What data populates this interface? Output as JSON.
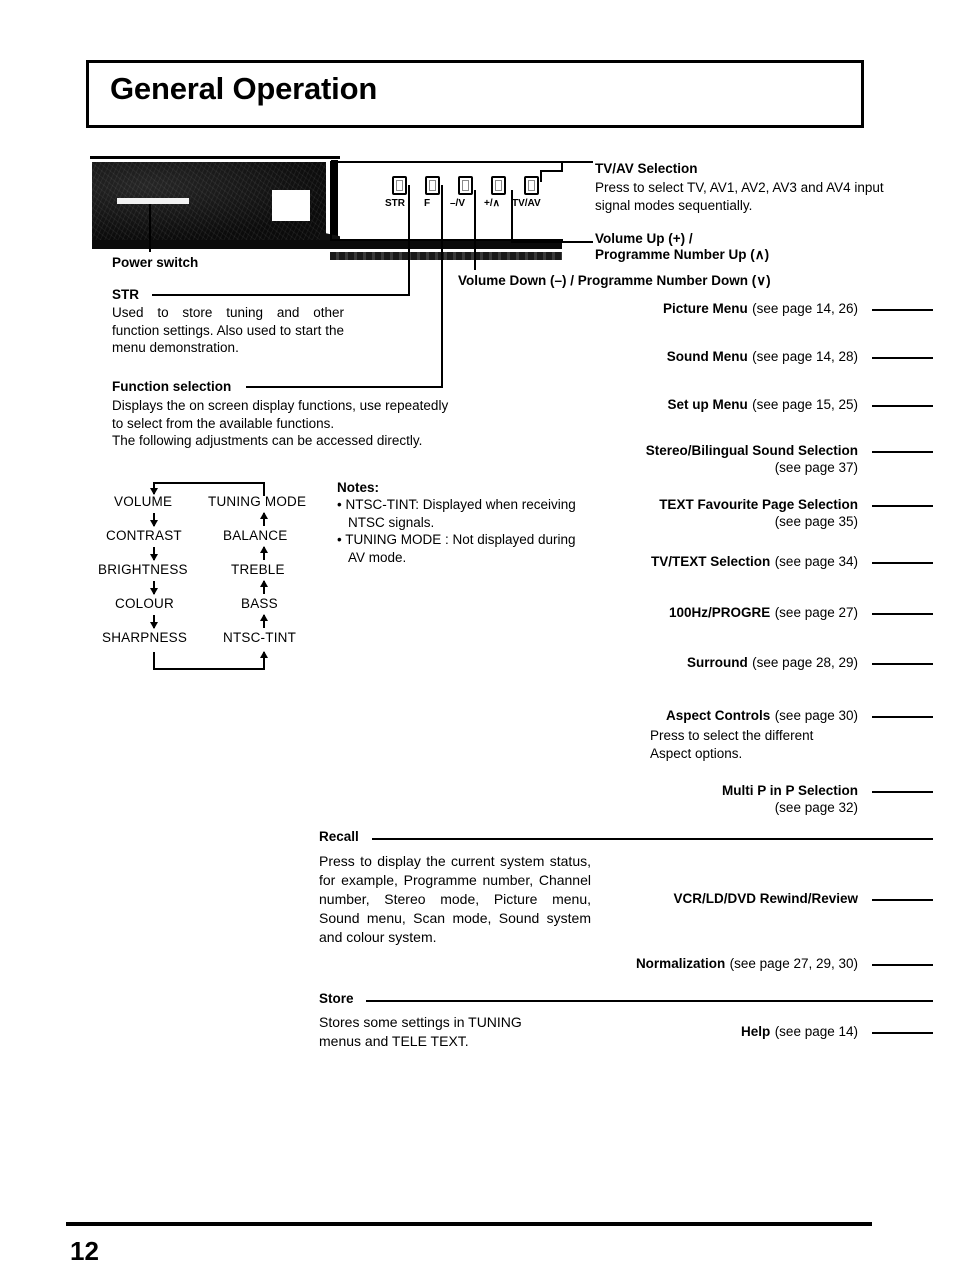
{
  "page": {
    "title": "General Operation",
    "number": "12"
  },
  "photo": {
    "power_switch_label": "Power switch"
  },
  "control_panel": {
    "buttons": [
      {
        "label": "STR"
      },
      {
        "label": "F"
      },
      {
        "label": "–/V"
      },
      {
        "label": "+/∧"
      },
      {
        "label": "TV/AV"
      }
    ]
  },
  "callouts": {
    "tvav": {
      "heading": "TV/AV Selection",
      "body": "Press to select TV, AV1, AV2, AV3 and AV4 input signal modes sequentially."
    },
    "volume_up": {
      "line1": "Volume Up (+) /",
      "line2_bold": "Programme Number Up (",
      "line2_glyph": "∧",
      "line2_end": ")"
    },
    "volume_down": {
      "text": "Volume Down (–) / Programme Number Down (∨)"
    },
    "str": {
      "heading": "STR",
      "body": "Used to store tuning and other function settings. Also used to start the menu demonstration."
    },
    "function_selection": {
      "heading": "Function selection",
      "line1": "Displays the on screen display functions, use repeatedly",
      "line2": "to select from the available functions.",
      "line3": "The following adjustments can be accessed directly."
    },
    "recall": {
      "heading": "Recall",
      "body": "Press to display the current system status, for example, Programme number, Channel number, Stereo mode, Picture menu, Sound menu, Scan mode, Sound system and colour system."
    },
    "store": {
      "heading": "Store",
      "line1": "Stores some settings in TUNING",
      "line2": "menus and TELE TEXT."
    }
  },
  "flow_diagram": {
    "left_column": [
      "VOLUME",
      "CONTRAST",
      "BRIGHTNESS",
      "COLOUR",
      "SHARPNESS"
    ],
    "right_column": [
      "TUNING MODE",
      "BALANCE",
      "TREBLE",
      "BASS",
      "NTSC-TINT"
    ]
  },
  "notes": {
    "title": "Notes:",
    "items": [
      "NTSC-TINT: Displayed when receiving NTSC   signals.",
      "TUNING MODE : Not displayed during AV mode."
    ]
  },
  "right_column": [
    {
      "name": "Picture Menu",
      "page": "(see page 14, 26)",
      "sub": ""
    },
    {
      "name": "Sound Menu",
      "page": "(see page 14, 28)",
      "sub": ""
    },
    {
      "name": "Set up Menu",
      "page": "(see page 15, 25)",
      "sub": ""
    },
    {
      "name": "Stereo/Bilingual Sound Selection",
      "page": "",
      "sub": "(see page 37)"
    },
    {
      "name": "TEXT Favourite Page Selection",
      "page": "",
      "sub": "(see page 35)"
    },
    {
      "name": "TV/TEXT Selection",
      "page": "(see page 34)",
      "sub": ""
    },
    {
      "name": "100Hz/PROGRE",
      "page": "(see page 27)",
      "sub": ""
    },
    {
      "name": "Surround",
      "page": "(see page 28, 29)",
      "sub": ""
    },
    {
      "name": "Aspect Controls",
      "page": "(see page 30)",
      "sub": ""
    },
    {
      "name": "Multi P in P Selection",
      "page": "",
      "sub": "(see page 32)"
    },
    {
      "name": "VCR/LD/DVD Rewind/Review",
      "page": "",
      "sub": ""
    },
    {
      "name": "Normalization",
      "page": "(see page 27, 29, 30)",
      "sub": ""
    },
    {
      "name": "Help",
      "page": "(see page 14)",
      "sub": ""
    }
  ],
  "aspect_extra": {
    "line1": "Press  to  select  the  different",
    "line2": "Aspect options."
  }
}
